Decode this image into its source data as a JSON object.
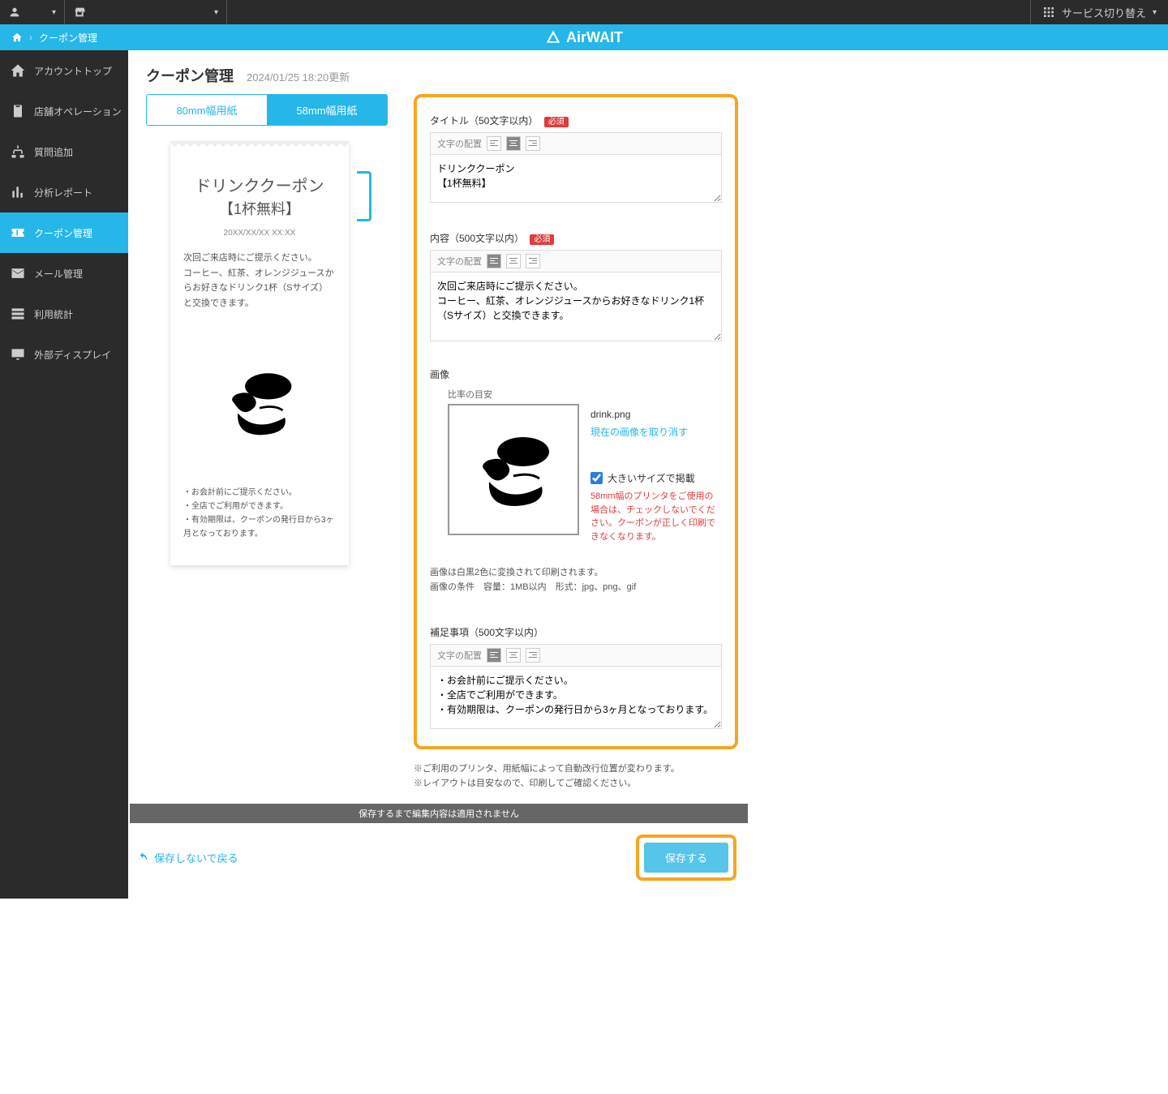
{
  "topbar": {
    "service_switch": "サービス切り替え"
  },
  "breadcrumb": {
    "current": "クーポン管理"
  },
  "logo": "AirWAIT",
  "sidebar": {
    "items": [
      {
        "label": "アカウントトップ"
      },
      {
        "label": "店舗オペレーション"
      },
      {
        "label": "質問追加"
      },
      {
        "label": "分析レポート"
      },
      {
        "label": "クーポン管理"
      },
      {
        "label": "メール管理"
      },
      {
        "label": "利用統計"
      },
      {
        "label": "外部ディスプレイ"
      }
    ]
  },
  "page": {
    "title": "クーポン管理",
    "timestamp": "2024/01/25 18:20更新"
  },
  "tabs": {
    "t0": "80mm幅用紙",
    "t1": "58mm幅用紙"
  },
  "preview": {
    "title": "ドリンククーポン",
    "subtitle": "【1杯無料】",
    "date": "20XX/XX/XX   XX:XX",
    "body": "次回ご来店時にご提示ください。\nコーヒー、紅茶、オレンジジュースからお好きなドリンク1杯（Sサイズ）と交換できます。",
    "notes": "・お会計前にご提示ください。\n・全店でご利用ができます。\n・有効期限は、クーポンの発行日から3ヶ月となっております。"
  },
  "form": {
    "title_label": "タイトル（50文字以内）",
    "content_label": "内容（500文字以内）",
    "required": "必須",
    "align_label": "文字の配置",
    "title_value": "ドリンククーポン\n【1杯無料】",
    "content_value": "次回ご来店時にご提示ください。\nコーヒー、紅茶、オレンジジュースからお好きなドリンク1杯（Sサイズ）と交換できます。",
    "image_label": "画像",
    "ratio_label": "比率の目安",
    "filename": "drink.png",
    "cancel_image": "現在の画像を取り消す",
    "large_checkbox": "大きいサイズで掲載",
    "large_warning": "58mm幅のプリンタをご使用の場合は、チェックしないでください。クーポンが正しく印刷できなくなります。",
    "img_hint1": "画像は白黒2色に変換されて印刷されます。",
    "img_hint2": "画像の条件　容量：1MB以内　形式：jpg、png、gif",
    "notes_label": "補足事項（500文字以内）",
    "notes_value": "・お会計前にご提示ください。\n・全店でご利用ができます。\n・有効期限は、クーポンの発行日から3ヶ月となっております。"
  },
  "footer": {
    "note1": "※ご利用のプリンタ、用紙幅によって自動改行位置が変わります。",
    "note2": "※レイアウトは目安なので、印刷してご確認ください。",
    "warn": "保存するまで編集内容は適用されません",
    "back": "保存しないで戻る",
    "save": "保存する"
  }
}
